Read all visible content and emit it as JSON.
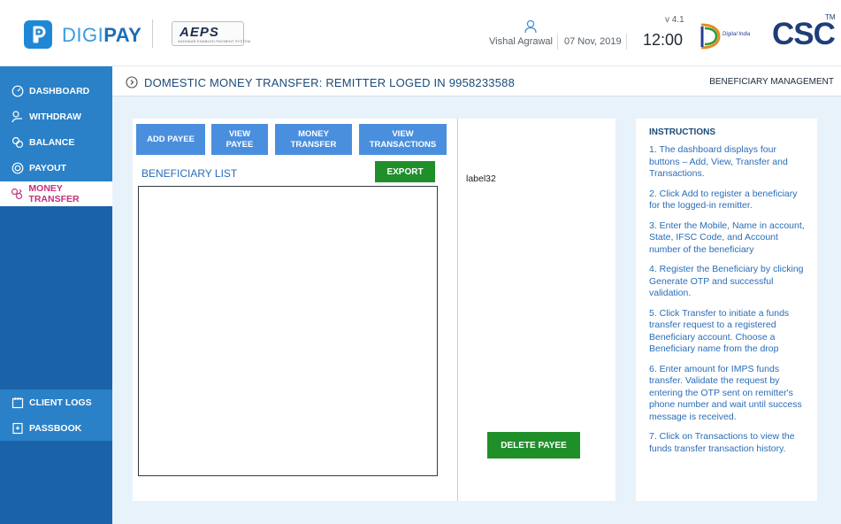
{
  "header": {
    "brand_part1": "DIGI",
    "brand_part2": "PAY",
    "aeps_logo_text": "AEPS",
    "aeps_logo_subtitle": "AADHAAR ENABLED PAYMENT SYSTEM",
    "user_name": "Vishal Agrawal",
    "date": "07 Nov, 2019",
    "version": "v 4.1",
    "time": "12:00",
    "digital_india_text": "Digital India",
    "csc_logo": "CSC",
    "csc_tm": "TM"
  },
  "sidebar": {
    "items": [
      {
        "label": "DASHBOARD",
        "icon": "dashboard-icon"
      },
      {
        "label": "WITHDRAW",
        "icon": "withdraw-icon"
      },
      {
        "label": "BALANCE",
        "icon": "balance-icon"
      },
      {
        "label": "PAYOUT",
        "icon": "payout-icon"
      },
      {
        "label": "MONEY TRANSFER",
        "icon": "money-transfer-icon",
        "active": true
      },
      {
        "label": "CLIENT LOGS",
        "icon": "client-logs-icon"
      },
      {
        "label": "PASSBOOK",
        "icon": "passbook-icon"
      }
    ]
  },
  "main": {
    "title": "DOMESTIC MONEY TRANSFER: REMITTER LOGED IN 9958233588",
    "section": "BENEFICIARY MANAGEMENT",
    "buttons": {
      "add_payee": "ADD PAYEE",
      "view_payee_line1": "VIEW",
      "view_payee_line2": "PAYEE",
      "money_transfer_line1": "MONEY",
      "money_transfer_line2": "TRANSFER",
      "view_transactions_line1": "VIEW",
      "view_transactions_line2": "TRANSACTIONS",
      "export": "EXPORT",
      "delete_payee": "DELETE PAYEE"
    },
    "beneficiary_list_label": "BENEFICIARY LIST",
    "placeholder_label": "label32"
  },
  "instructions": {
    "title": "INSTRUCTIONS",
    "items": [
      "1. The dashboard displays four buttons – Add, View, Transfer and Transactions.",
      "2. Click Add to register a beneficiary for the logged-in remitter.",
      "3. Enter the Mobile, Name in account, State, IFSC Code, and Account number of the beneficiary",
      "4. Register the Beneficiary by clicking Generate OTP and successful validation.",
      "5. Click Transfer to initiate a funds transfer request to a registered Beneficiary account. Choose a Beneficiary name from the drop",
      "6. Enter amount for IMPS funds transfer. Validate the request by entering the OTP sent on remitter's phone number and wait until success message is received.",
      "7. Click on Transactions to view the funds transfer transaction history."
    ]
  },
  "colors": {
    "sidebar_dark": "#1b63a9",
    "sidebar_light": "#2a81c8",
    "action_blue": "#4a8fdd",
    "action_green": "#1f8f2a",
    "active_pink": "#c2307a"
  }
}
